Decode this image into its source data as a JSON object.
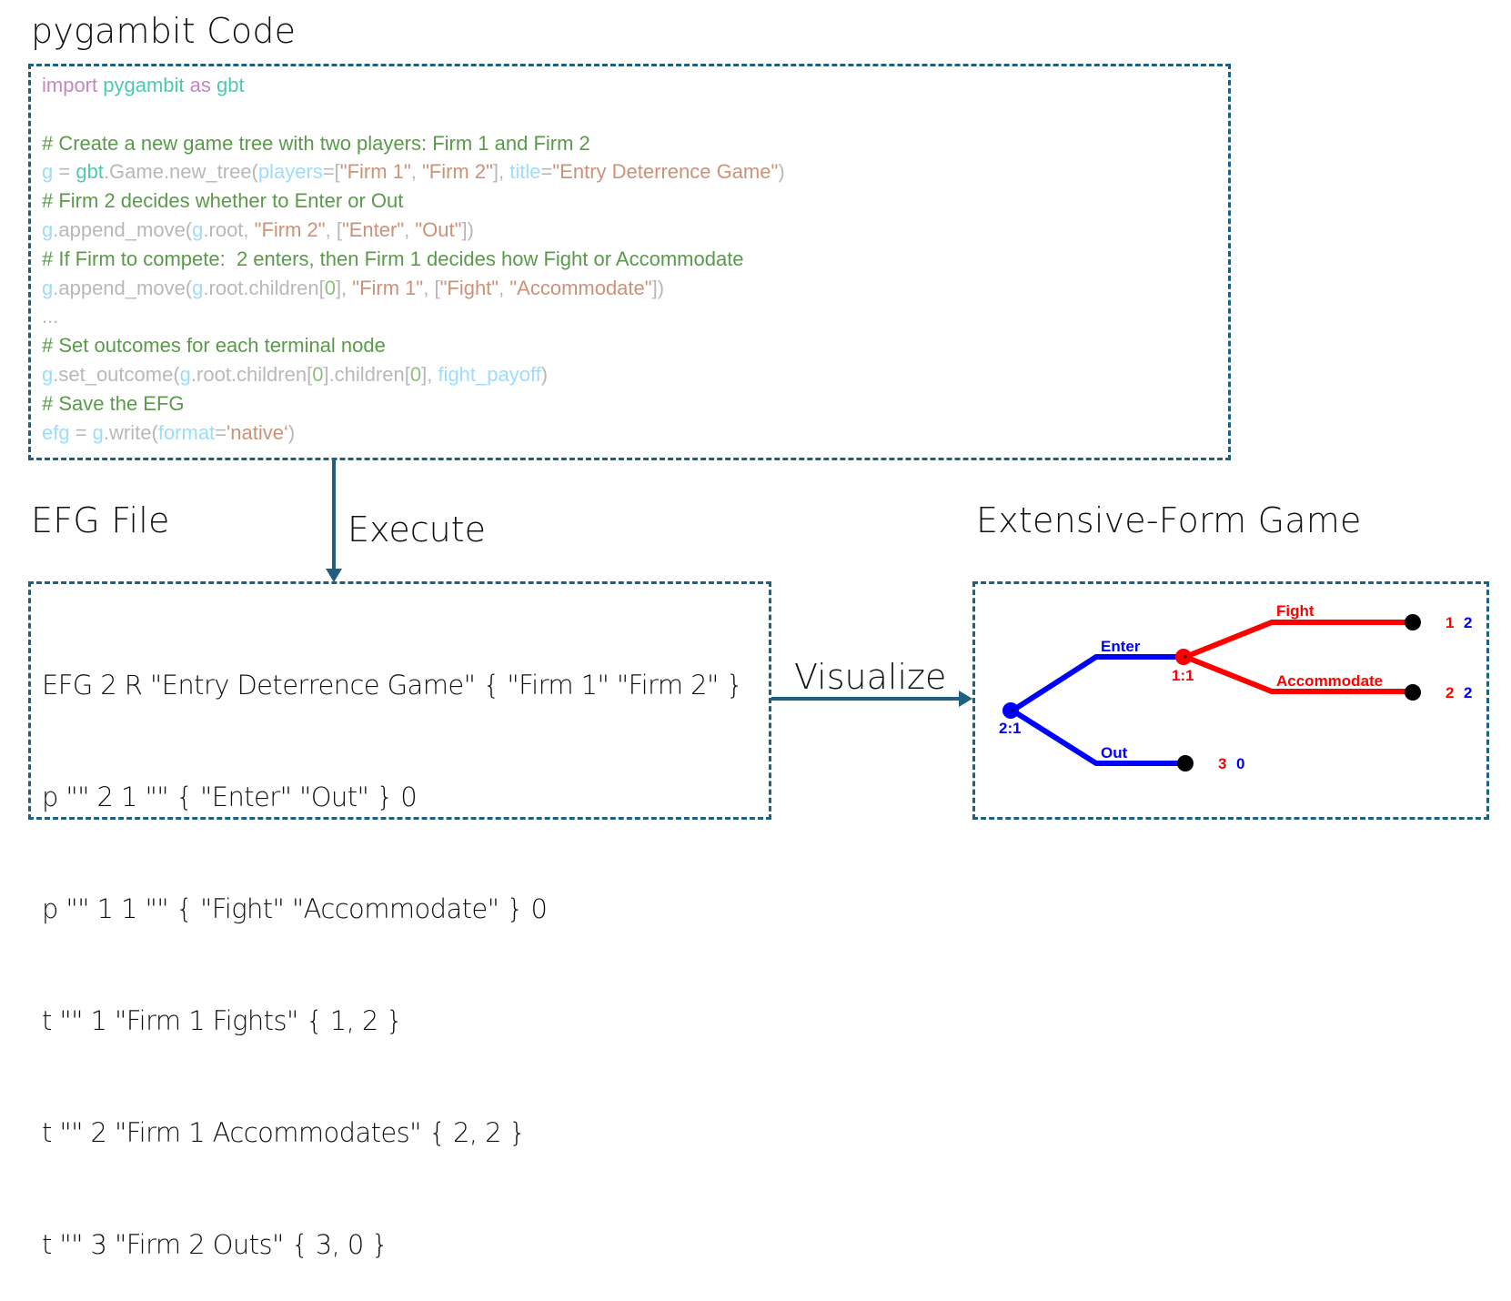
{
  "sections": {
    "code_title": "pygambit Code",
    "efg_title": "EFG File",
    "game_title": "Extensive-Form Game"
  },
  "arrows": {
    "execute_label": "Execute",
    "visualize_label": "Visualize"
  },
  "colors": {
    "box_border": "#1f5f7f",
    "arrow": "#1f5f7f",
    "player1": "#ff0000",
    "player2": "#0000ff",
    "terminal": "#000000"
  },
  "code": {
    "lines": [
      [
        {
          "t": "import ",
          "c": "kw"
        },
        {
          "t": "pygambit ",
          "c": "mod"
        },
        {
          "t": "as ",
          "c": "kw"
        },
        {
          "t": "gbt",
          "c": "mod"
        }
      ],
      [],
      [
        {
          "t": "# Create a new game tree with two players: Firm 1 and Firm 2",
          "c": "cm"
        }
      ],
      [
        {
          "t": "g",
          "c": "var"
        },
        {
          "t": " = ",
          "c": "plain"
        },
        {
          "t": "gbt",
          "c": "mod"
        },
        {
          "t": ".Game.new_tree(",
          "c": "plain"
        },
        {
          "t": "players",
          "c": "var"
        },
        {
          "t": "=[",
          "c": "plain"
        },
        {
          "t": "\"Firm 1\"",
          "c": "str"
        },
        {
          "t": ", ",
          "c": "plain"
        },
        {
          "t": "\"Firm 2\"",
          "c": "str"
        },
        {
          "t": "], ",
          "c": "plain"
        },
        {
          "t": "title",
          "c": "var"
        },
        {
          "t": "=",
          "c": "plain"
        },
        {
          "t": "\"Entry Deterrence Game\"",
          "c": "str"
        },
        {
          "t": ")",
          "c": "plain"
        }
      ],
      [
        {
          "t": "# Firm 2 decides whether to Enter or Out",
          "c": "cm"
        }
      ],
      [
        {
          "t": "g",
          "c": "var"
        },
        {
          "t": ".append_move(",
          "c": "plain"
        },
        {
          "t": "g",
          "c": "var"
        },
        {
          "t": ".root, ",
          "c": "plain"
        },
        {
          "t": "\"Firm 2\"",
          "c": "str"
        },
        {
          "t": ", [",
          "c": "plain"
        },
        {
          "t": "\"Enter\"",
          "c": "str"
        },
        {
          "t": ", ",
          "c": "plain"
        },
        {
          "t": "\"Out\"",
          "c": "str"
        },
        {
          "t": "])",
          "c": "plain"
        }
      ],
      [
        {
          "t": "# If Firm to compete:  2 enters, then Firm 1 decides how Fight or Accommodate",
          "c": "cm"
        }
      ],
      [
        {
          "t": "g",
          "c": "var"
        },
        {
          "t": ".append_move(",
          "c": "plain"
        },
        {
          "t": "g",
          "c": "var"
        },
        {
          "t": ".root.children[",
          "c": "plain"
        },
        {
          "t": "0",
          "c": "num"
        },
        {
          "t": "], ",
          "c": "plain"
        },
        {
          "t": "\"Firm 1\"",
          "c": "str"
        },
        {
          "t": ", [",
          "c": "plain"
        },
        {
          "t": "\"Fight\"",
          "c": "str"
        },
        {
          "t": ", ",
          "c": "plain"
        },
        {
          "t": "\"Accommodate\"",
          "c": "str"
        },
        {
          "t": "])",
          "c": "plain"
        }
      ],
      [
        {
          "t": "...",
          "c": "plain"
        }
      ],
      [
        {
          "t": "# Set outcomes for each terminal node",
          "c": "cm"
        }
      ],
      [
        {
          "t": "g",
          "c": "var"
        },
        {
          "t": ".set_outcome(",
          "c": "plain"
        },
        {
          "t": "g",
          "c": "var"
        },
        {
          "t": ".root.children[",
          "c": "plain"
        },
        {
          "t": "0",
          "c": "num"
        },
        {
          "t": "].children[",
          "c": "plain"
        },
        {
          "t": "0",
          "c": "num"
        },
        {
          "t": "], ",
          "c": "plain"
        },
        {
          "t": "fight_payoff",
          "c": "var"
        },
        {
          "t": ")",
          "c": "plain"
        }
      ],
      [
        {
          "t": "# Save the EFG",
          "c": "cm"
        }
      ],
      [
        {
          "t": "efg",
          "c": "var"
        },
        {
          "t": " = ",
          "c": "plain"
        },
        {
          "t": "g",
          "c": "var"
        },
        {
          "t": ".write(",
          "c": "plain"
        },
        {
          "t": "format",
          "c": "var"
        },
        {
          "t": "=",
          "c": "plain"
        },
        {
          "t": "'native‘",
          "c": "str"
        },
        {
          "t": ")",
          "c": "plain"
        }
      ]
    ]
  },
  "efg_file": {
    "lines": [
      "EFG 2 R \"Entry Deterrence Game\" { \"Firm 1\" \"Firm 2\" }",
      "p \"\" 2 1 \"\" { \"Enter\" \"Out\" } 0",
      "p \"\" 1 1 \"\" { \"Fight\" \"Accommodate\" } 0",
      "t \"\" 1 \"Firm 1 Fights\" { 1, 2 }",
      "t \"\" 2 \"Firm 1 Accommodates\" { 2, 2 }",
      "t \"\" 3 \"Firm 2 Outs\" { 3, 0 }"
    ]
  },
  "game_tree": {
    "root": {
      "label": "2:1",
      "player": 2
    },
    "firm1_node": {
      "label": "1:1",
      "player": 1
    },
    "actions": {
      "enter": "Enter",
      "out": "Out",
      "fight": "Fight",
      "accommodate": "Accommodate"
    },
    "payoffs": {
      "fight": [
        "1",
        "2"
      ],
      "accommodate": [
        "2",
        "2"
      ],
      "out": [
        "3",
        "0"
      ]
    }
  }
}
